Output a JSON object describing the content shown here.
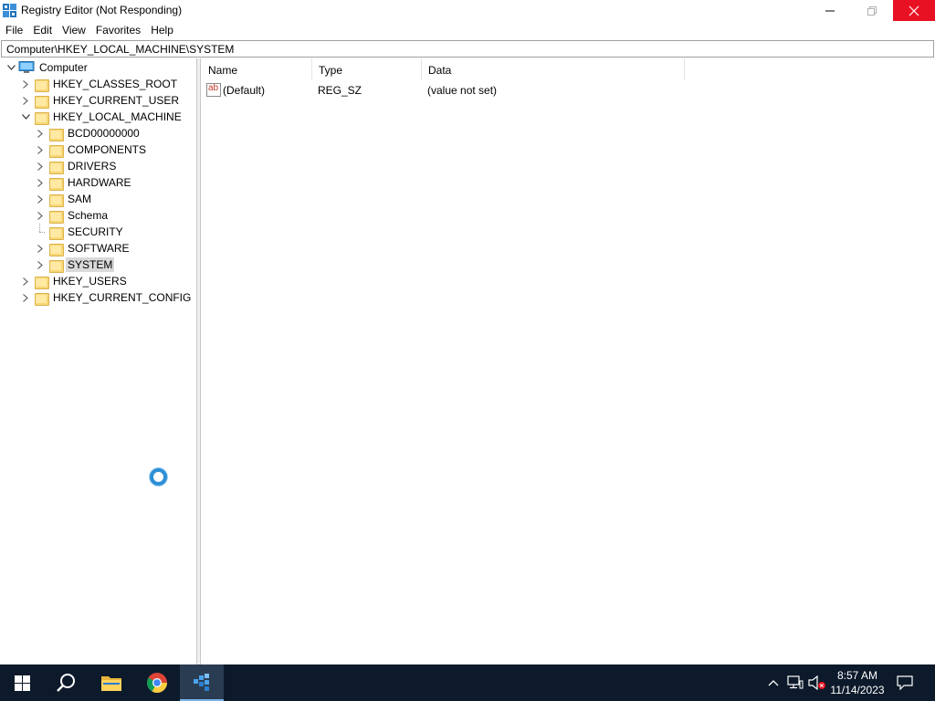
{
  "window": {
    "title": "Registry Editor (Not Responding)",
    "icon": "regedit-icon"
  },
  "menu": [
    "File",
    "Edit",
    "View",
    "Favorites",
    "Help"
  ],
  "address": "Computer\\HKEY_LOCAL_MACHINE\\SYSTEM",
  "tree": {
    "root": "Computer",
    "hives": [
      "HKEY_CLASSES_ROOT",
      "HKEY_CURRENT_USER",
      "HKEY_LOCAL_MACHINE",
      "HKEY_USERS",
      "HKEY_CURRENT_CONFIG"
    ],
    "hklm_children": [
      "BCD00000000",
      "COMPONENTS",
      "DRIVERS",
      "HARDWARE",
      "SAM",
      "Schema",
      "SECURITY",
      "SOFTWARE",
      "SYSTEM"
    ],
    "selected": "SYSTEM"
  },
  "list": {
    "columns": [
      "Name",
      "Type",
      "Data"
    ],
    "rows": [
      {
        "name": "(Default)",
        "type": "REG_SZ",
        "data": "(value not set)"
      }
    ]
  },
  "taskbar": {
    "apps": [
      "start-icon",
      "search-icon",
      "file-explorer-icon",
      "chrome-icon",
      "regedit-icon"
    ],
    "time": "8:57 AM",
    "date": "11/14/2023"
  },
  "colors": {
    "close_button": "#e81123",
    "taskbar": "#0d1a2b",
    "selection": "#d9d9d9",
    "folder": "#f8d775"
  }
}
